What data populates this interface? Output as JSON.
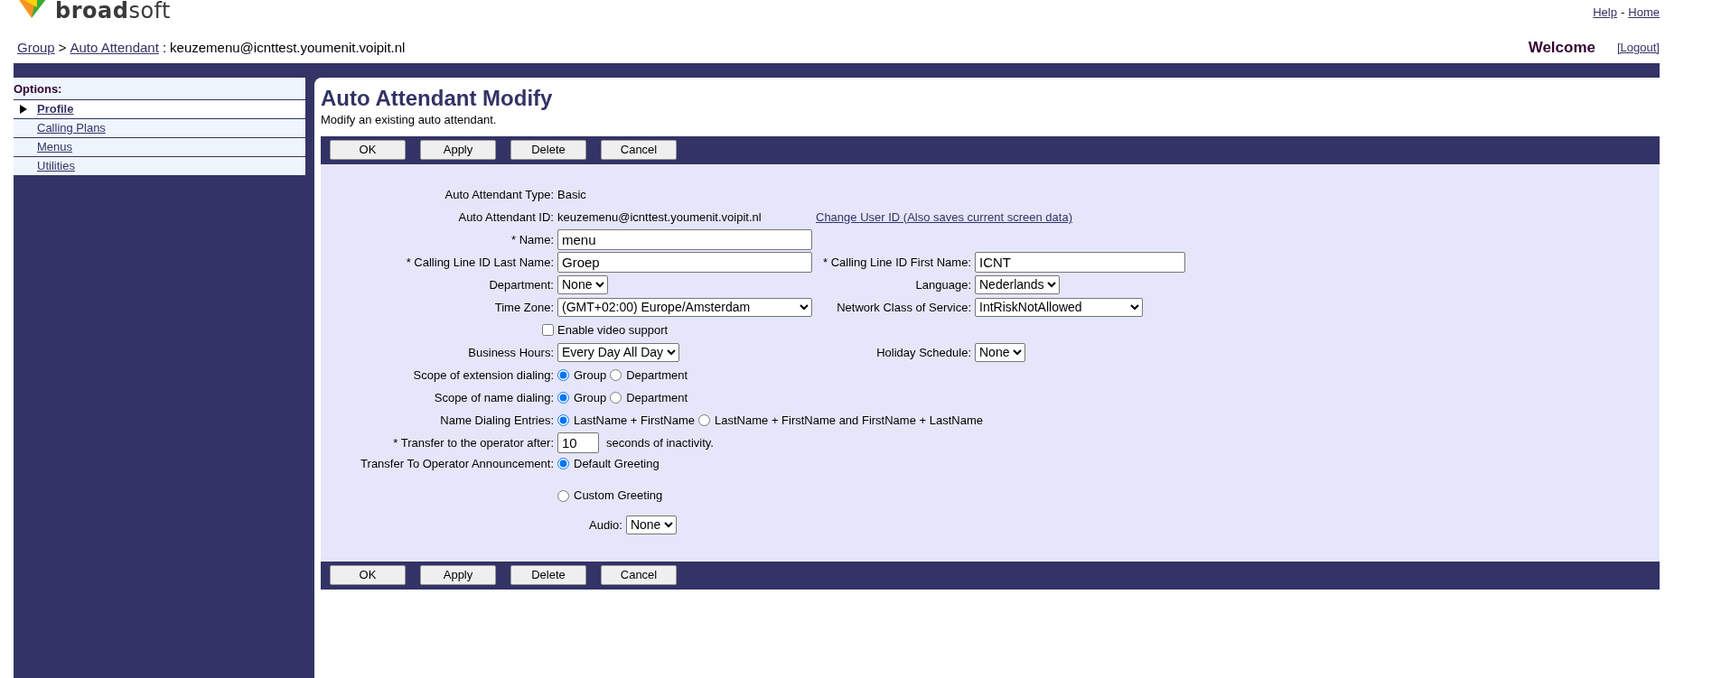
{
  "logo": {
    "text": "**broad**soft"
  },
  "header_links": {
    "items": [
      {
        "label": "Help"
      },
      {
        "label": "Home"
      }
    ],
    "separator": "-"
  },
  "breadcrumb": {
    "items": [
      {
        "label": "Group"
      },
      {
        "label": "Auto Attendant"
      }
    ],
    "separator": ">",
    "current_separator": ":",
    "current": "keuzemenu@icnttest.youmenit.voipit.nl"
  },
  "welcome": "Welcome",
  "logout": "[Logout]",
  "sidebar": {
    "title": "Options:",
    "items": [
      {
        "label": "Profile",
        "selected": true
      },
      {
        "label": "Calling Plans",
        "selected": false
      },
      {
        "label": "Menus",
        "selected": false
      },
      {
        "label": "Utilities",
        "selected": false
      }
    ]
  },
  "page": {
    "title": "Auto Attendant Modify",
    "description": "Modify an existing auto attendant."
  },
  "top_buttons": [
    "OK",
    "Apply",
    "Delete",
    "Cancel"
  ],
  "form_rows": [
    {
      "cells": [
        {
          "kind": "text",
          "label": "Auto Attendant Type:",
          "value": "Basic"
        }
      ]
    },
    {
      "cells": [
        {
          "kind": "text",
          "label": "Auto Attendant ID:",
          "value": "keuzemenu@icnttest.youmenit.voipit.nl",
          "link": "Change User ID (Also saves current screen data)"
        }
      ]
    },
    {
      "cells": [
        {
          "kind": "input",
          "label": "* Name:",
          "value": "menu"
        }
      ]
    },
    {
      "cells": [
        {
          "kind": "input",
          "label": "* Calling Line ID Last Name:",
          "value": "Groep"
        },
        {
          "kind": "input",
          "label": "* Calling Line ID First Name:",
          "value": "ICNT"
        }
      ]
    },
    {
      "cells": [
        {
          "kind": "select",
          "label": "Department:",
          "value": "None"
        },
        {
          "kind": "select",
          "label": "Language:",
          "value": "Nederlands"
        }
      ]
    },
    {
      "cells": [
        {
          "kind": "long_select",
          "label": "Time Zone:",
          "value": "(GMT+02:00) Europe/Amsterdam"
        },
        {
          "kind": "long_select",
          "label": "Network Class of Service:",
          "value": "IntRiskNotAllowed"
        }
      ]
    },
    {
      "cells": [
        {
          "kind": "checkbox",
          "label": "Enable video support",
          "checked": false
        }
      ]
    },
    {
      "cells": [
        {
          "kind": "select",
          "label": "Business Hours:",
          "value": "Every Day All Day"
        },
        {
          "kind": "select",
          "label": "Holiday Schedule:",
          "value": "None"
        }
      ]
    },
    {
      "cells": [
        {
          "kind": "radio",
          "label": "Scope of extension dialing:",
          "options": [
            {
              "label": "Group",
              "selected": true
            },
            {
              "label": "Department",
              "selected": false
            }
          ]
        }
      ]
    },
    {
      "cells": [
        {
          "kind": "radio",
          "label": "Scope of name dialing:",
          "options": [
            {
              "label": "Group",
              "selected": true
            },
            {
              "label": "Department",
              "selected": false
            }
          ]
        }
      ]
    },
    {
      "cells": [
        {
          "kind": "radio",
          "label": "Name Dialing Entries:",
          "options": [
            {
              "label": "LastName + FirstName",
              "selected": true
            },
            {
              "label": "LastName + FirstName and FirstName + LastName",
              "selected": false
            }
          ]
        }
      ]
    },
    {
      "cells": [
        {
          "kind": "input_suffix",
          "label": "* Transfer to the operator after:",
          "value": "10",
          "suffix": "seconds of inactivity."
        }
      ]
    },
    {
      "cells": [
        {
          "kind": "radio_stack",
          "label": "Transfer To Operator Announcement:",
          "options": [
            {
              "label": "Default Greeting",
              "selected": true
            },
            {
              "label": "Custom Greeting",
              "selected": false
            }
          ]
        }
      ]
    },
    {
      "cells": [
        {
          "kind": "sub_select",
          "label": "Audio:",
          "value": "None"
        }
      ]
    }
  ],
  "bottom_buttons": [
    "OK",
    "Apply",
    "Delete",
    "Cancel"
  ]
}
